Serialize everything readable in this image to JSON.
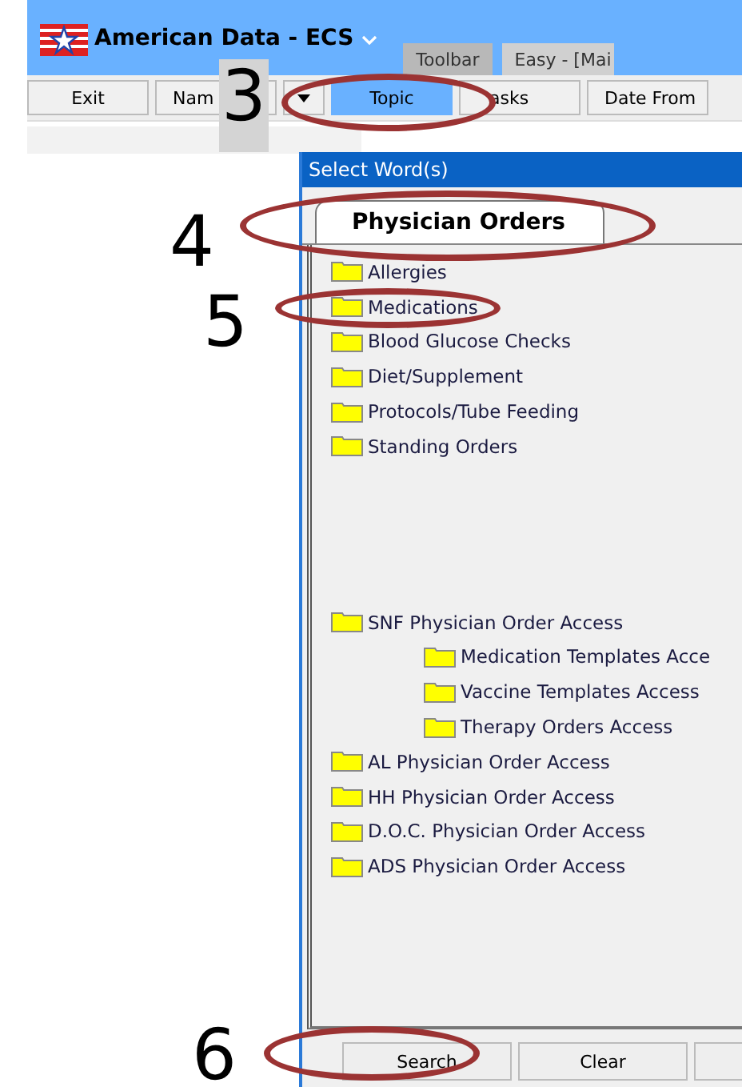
{
  "window": {
    "title": "American Data - ECS",
    "tabs": [
      {
        "label": "Toolbar",
        "selected": false
      },
      {
        "label": "Easy - [Mai",
        "selected": true
      }
    ]
  },
  "toolbar": [
    {
      "kind": "button",
      "label": "Exit",
      "selected": false
    },
    {
      "kind": "button",
      "label": "Nam",
      "selected": false
    },
    {
      "kind": "dropdown",
      "selected": false
    },
    {
      "kind": "button",
      "label": "Topic",
      "selected": true
    },
    {
      "kind": "button",
      "label": "asks",
      "selected": false
    },
    {
      "kind": "button",
      "label": "Date From",
      "selected": false
    }
  ],
  "dialog": {
    "title": "Select Word(s)",
    "tabs": [
      {
        "label": "Physician Orders",
        "selected": true
      }
    ],
    "tree_groups": [
      {
        "items": [
          {
            "label": "Allergies"
          },
          {
            "label": "Medications"
          },
          {
            "label": "Blood Glucose Checks"
          },
          {
            "label": "Diet/Supplement"
          },
          {
            "label": "Protocols/Tube Feeding"
          },
          {
            "label": "Standing Orders"
          }
        ]
      },
      {
        "items": [
          {
            "label": "SNF Physician Order Access",
            "children": [
              {
                "label": "Medication Templates Acce"
              },
              {
                "label": "Vaccine Templates Access"
              },
              {
                "label": "Therapy Orders Access"
              }
            ]
          },
          {
            "label": "AL Physician Order Access"
          },
          {
            "label": "HH Physician Order Access"
          },
          {
            "label": "D.O.C. Physician Order Access"
          },
          {
            "label": "ADS Physician Order Access"
          }
        ]
      }
    ],
    "buttons": [
      {
        "kind": "text",
        "label": "Search"
      },
      {
        "kind": "text",
        "label": "Clear"
      },
      {
        "kind": "blank"
      }
    ]
  },
  "annotations": [
    {
      "label": "3"
    },
    {
      "label": "4"
    },
    {
      "label": "5"
    },
    {
      "label": "6"
    }
  ]
}
